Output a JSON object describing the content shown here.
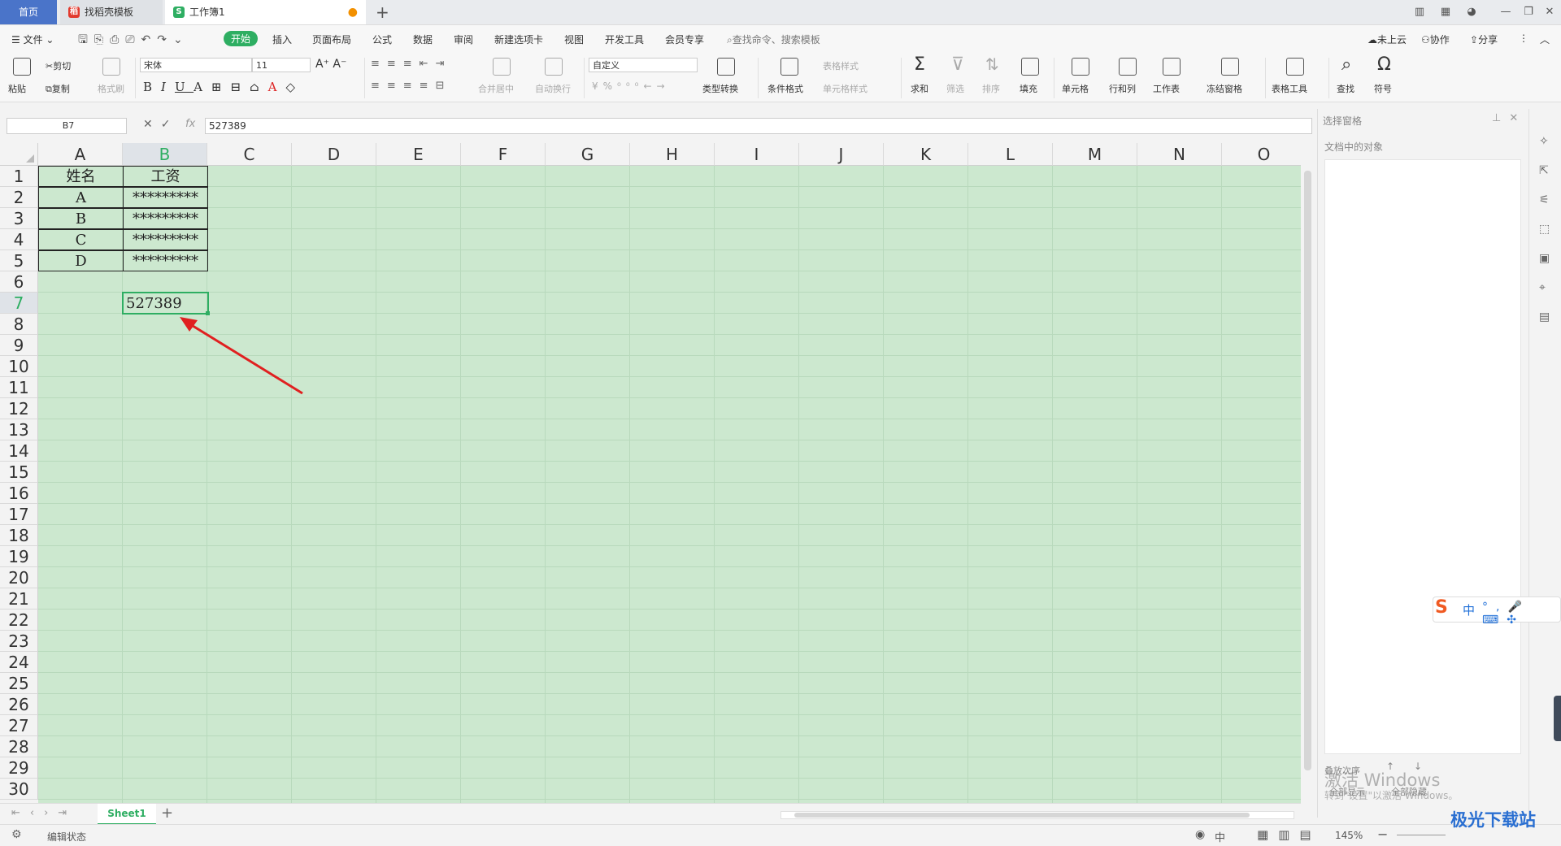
{
  "tabs": [
    {
      "label": "首页"
    },
    {
      "label": "找稻壳模板"
    },
    {
      "label": "工作簿1"
    }
  ],
  "menu": [
    "文件",
    "开始",
    "插入",
    "页面布局",
    "公式",
    "数据",
    "审阅",
    "新建选项卡",
    "视图",
    "开发工具",
    "会员专享"
  ],
  "search_placeholder": "查找命令、搜索模板",
  "top_right": {
    "cloud": "未上云",
    "collab": "协作",
    "share": "分享"
  },
  "ribbon": {
    "paste": "粘贴",
    "cut": "剪切",
    "copy": "复制",
    "format_painter": "格式刷",
    "font": "宋体",
    "size": "11",
    "number_format": "自定义",
    "merge": "合并居中",
    "wrap": "自动换行",
    "type_convert": "类型转换",
    "cond_format": "条件格式",
    "table_style": "表格样式",
    "cell_style": "单元格样式",
    "sum": "求和",
    "filter": "筛选",
    "sort": "排序",
    "fill": "填充",
    "cell": "单元格",
    "rowcol": "行和列",
    "worksheet": "工作表",
    "freeze": "冻结窗格",
    "table_tools": "表格工具",
    "find": "查找",
    "symbol": "符号"
  },
  "formula_bar": {
    "name_box": "B7",
    "fx": "fx",
    "value": "527389"
  },
  "columns": [
    "A",
    "B",
    "C",
    "D",
    "E",
    "F",
    "G",
    "H",
    "I",
    "J",
    "K",
    "L",
    "M",
    "N",
    "O"
  ],
  "rows": [
    "1",
    "2",
    "3",
    "4",
    "5",
    "6",
    "7",
    "8",
    "9",
    "10",
    "11",
    "12",
    "13",
    "14",
    "15",
    "16",
    "17",
    "18",
    "19",
    "20",
    "21",
    "22",
    "23",
    "24",
    "25",
    "26",
    "27",
    "28",
    "29",
    "30"
  ],
  "cells": {
    "a1": "姓名",
    "b1": "工资",
    "a2": "A",
    "b2": "*********",
    "a3": "B",
    "b3": "*********",
    "a4": "C",
    "b4": "*********",
    "a5": "D",
    "b5": "*********",
    "b7": "527389"
  },
  "panel": {
    "title": "选择窗格",
    "subtitle": "文档中的对象",
    "order": "叠放次序",
    "show_all": "全部显示",
    "hide_all": "全部隐藏"
  },
  "watermark": {
    "activate": "激活 Windows",
    "hint": "转到\"设置\"以激活 Windows。",
    "site": "极光下载站"
  },
  "ime": {
    "lang": "中"
  },
  "sheet": {
    "name": "Sheet1"
  },
  "status": {
    "mode": "编辑状态",
    "zoom": "145%",
    "lang": "中"
  }
}
